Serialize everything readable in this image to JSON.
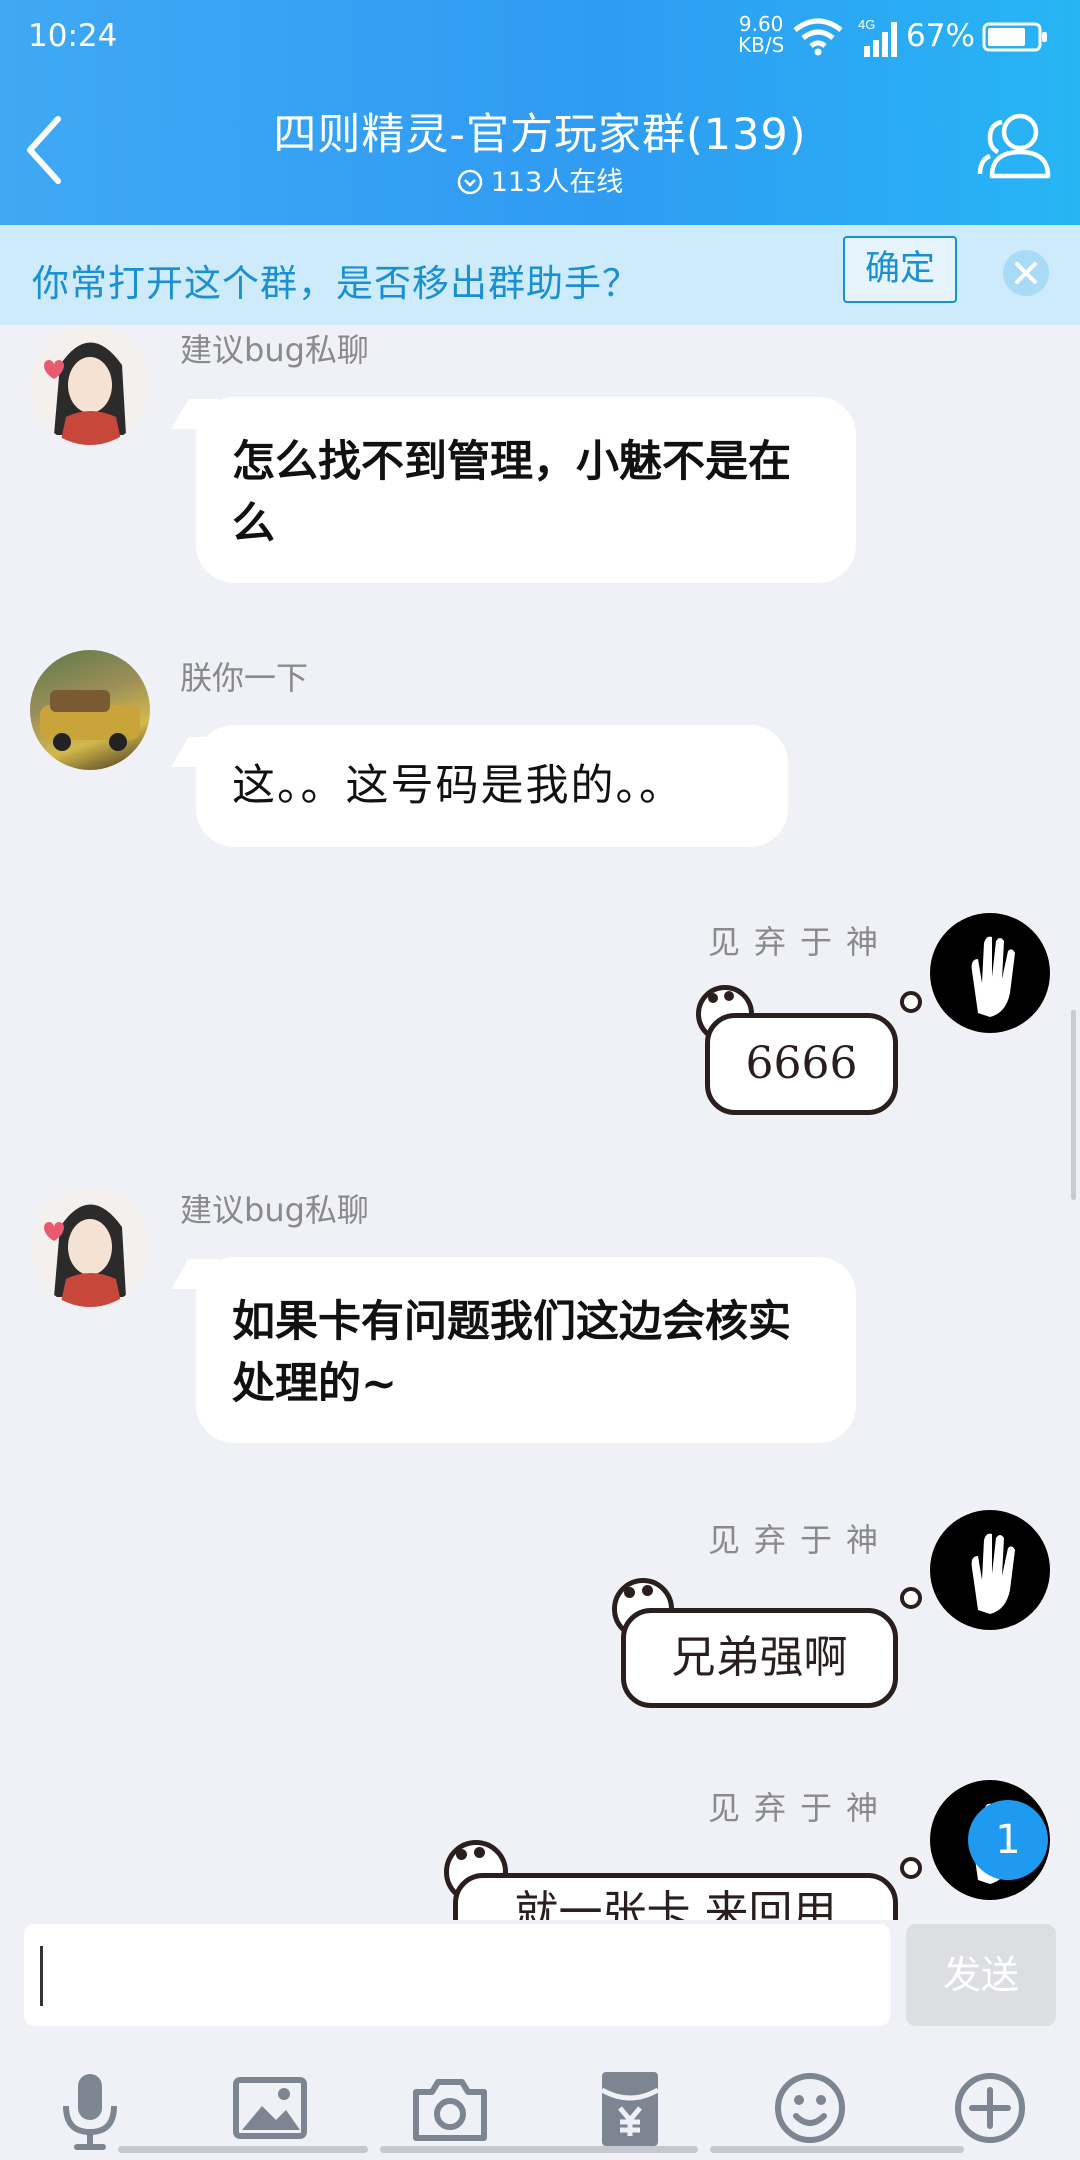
{
  "status_bar": {
    "time": "10:24",
    "net_speed_value": "9.60",
    "net_speed_unit": "KB/S",
    "signal_label": "4G",
    "battery": "67%"
  },
  "header": {
    "title": "四则精灵-官方玩家群(139)",
    "online": "113人在线"
  },
  "notice": {
    "text": "你常打开这个群，是否移出群助手？",
    "confirm": "确定"
  },
  "messages": [
    {
      "sender": "建议bug私聊",
      "text": "怎么找不到管理，小魅不是在么",
      "side": "left"
    },
    {
      "sender": "朕你一下",
      "text": "这。。这号码是我的。。",
      "side": "left"
    },
    {
      "sender": "见弃于神",
      "text": "6666",
      "side": "right"
    },
    {
      "sender": "建议bug私聊",
      "text": "如果卡有问题我们这边会核实处理的~",
      "side": "right"
    },
    {
      "sender": "见弃于神",
      "text": "兄弟强啊",
      "side": "right"
    },
    {
      "sender": "见弃于神",
      "text": "就一张卡 来回用",
      "side": "right"
    }
  ],
  "unread_badge": "1",
  "input": {
    "value": "",
    "send": "发送"
  },
  "toolbar_icons": [
    "microphone-icon",
    "image-icon",
    "camera-icon",
    "red-packet-icon",
    "emoji-icon",
    "plus-icon"
  ],
  "colors": {
    "header": "#2F9BF2",
    "notice_bg": "#CDEBFB",
    "accent": "#1A8FD4",
    "chat_bg": "#EFF1F6"
  }
}
